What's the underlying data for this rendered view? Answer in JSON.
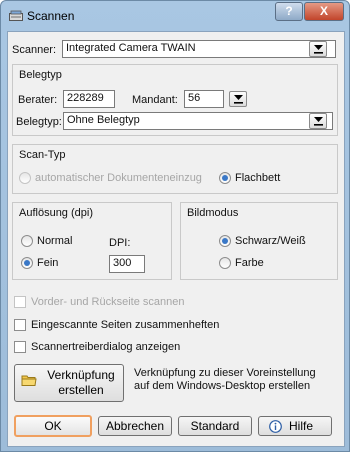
{
  "window": {
    "title": "Scannen",
    "help_label": "?",
    "close_label": "X"
  },
  "scanner": {
    "label": "Scanner:",
    "value": "Integrated Camera TWAIN"
  },
  "belegtyp_group": {
    "title": "Belegtyp",
    "berater_label": "Berater:",
    "berater_value": "228289",
    "mandant_label": "Mandant:",
    "mandant_value": "56",
    "belegtyp_label": "Belegtyp:",
    "belegtyp_value": "Ohne Belegtyp"
  },
  "scan_typ": {
    "title": "Scan-Typ",
    "option_auto": "automatischer Dokumenteneinzug",
    "option_flat": "Flachbett",
    "selected": "Flachbett"
  },
  "aufloesung": {
    "title": "Auflösung (dpi)",
    "option_normal": "Normal",
    "option_fein": "Fein",
    "selected": "Fein",
    "dpi_label": "DPI:",
    "dpi_value": "300"
  },
  "bildmodus": {
    "title": "Bildmodus",
    "option_sw": "Schwarz/Weiß",
    "option_farbe": "Farbe",
    "selected": "Schwarz/Weiß"
  },
  "checkboxes": {
    "duplex": "Vorder- und Rückseite scannen",
    "zusammenheften": "Eingescannte Seiten zusammenheften",
    "treiberdialog": "Scannertreiberdialog anzeigen"
  },
  "shortcut": {
    "line1": "Verknüpfung",
    "line2": "erstellen",
    "description": "Verknüpfung zu dieser Voreinstellung auf dem Windows-Desktop erstellen"
  },
  "buttons": {
    "ok": "OK",
    "cancel": "Abbrechen",
    "standard": "Standard",
    "help": "Hilfe"
  },
  "icons": {
    "title": "scanner-icon",
    "dropdown": "arrow-down-icon",
    "folder": "folder-icon",
    "help": "info-icon"
  }
}
